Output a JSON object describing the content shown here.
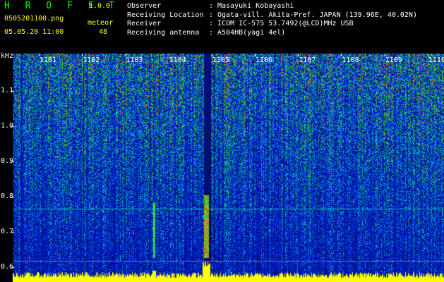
{
  "header": {
    "logo": "H R O F F T",
    "version": "1.0.0",
    "filename": "0505201100.png",
    "datetime": "05.05.20 11:00",
    "meteor_label": "meteor",
    "meteor_count": "48"
  },
  "info": [
    {
      "key": "Observer",
      "value": "Masayuki Kobayashi"
    },
    {
      "key": "Receiving Location",
      "value": "Ogata-vill. Akita-Pref. JAPAN (139.96E, 40.02N)"
    },
    {
      "key": "Receiver",
      "value": "ICOM IC-575 53.7492(@LCD)MHz USB"
    },
    {
      "key": "Receiving antenna",
      "value": "A504HB(yagi 4el)"
    }
  ],
  "info_separator": ":",
  "y_axis": {
    "unit": "kHz",
    "ticks": [
      "1.1",
      "1.0",
      "0.9",
      "0.8",
      "0.7",
      "0.6"
    ]
  },
  "x_axis": {
    "ticks": [
      "1101",
      "1102",
      "1103",
      "1104",
      "1105",
      "1106",
      "1107",
      "1108",
      "1109",
      "1110"
    ]
  },
  "colors": {
    "logo": "#00ff00",
    "text": "#ffff00",
    "info": "#ffffff",
    "axis": "#ffffff",
    "background_noise": "#1020b0",
    "signal": "#ffff00"
  }
}
